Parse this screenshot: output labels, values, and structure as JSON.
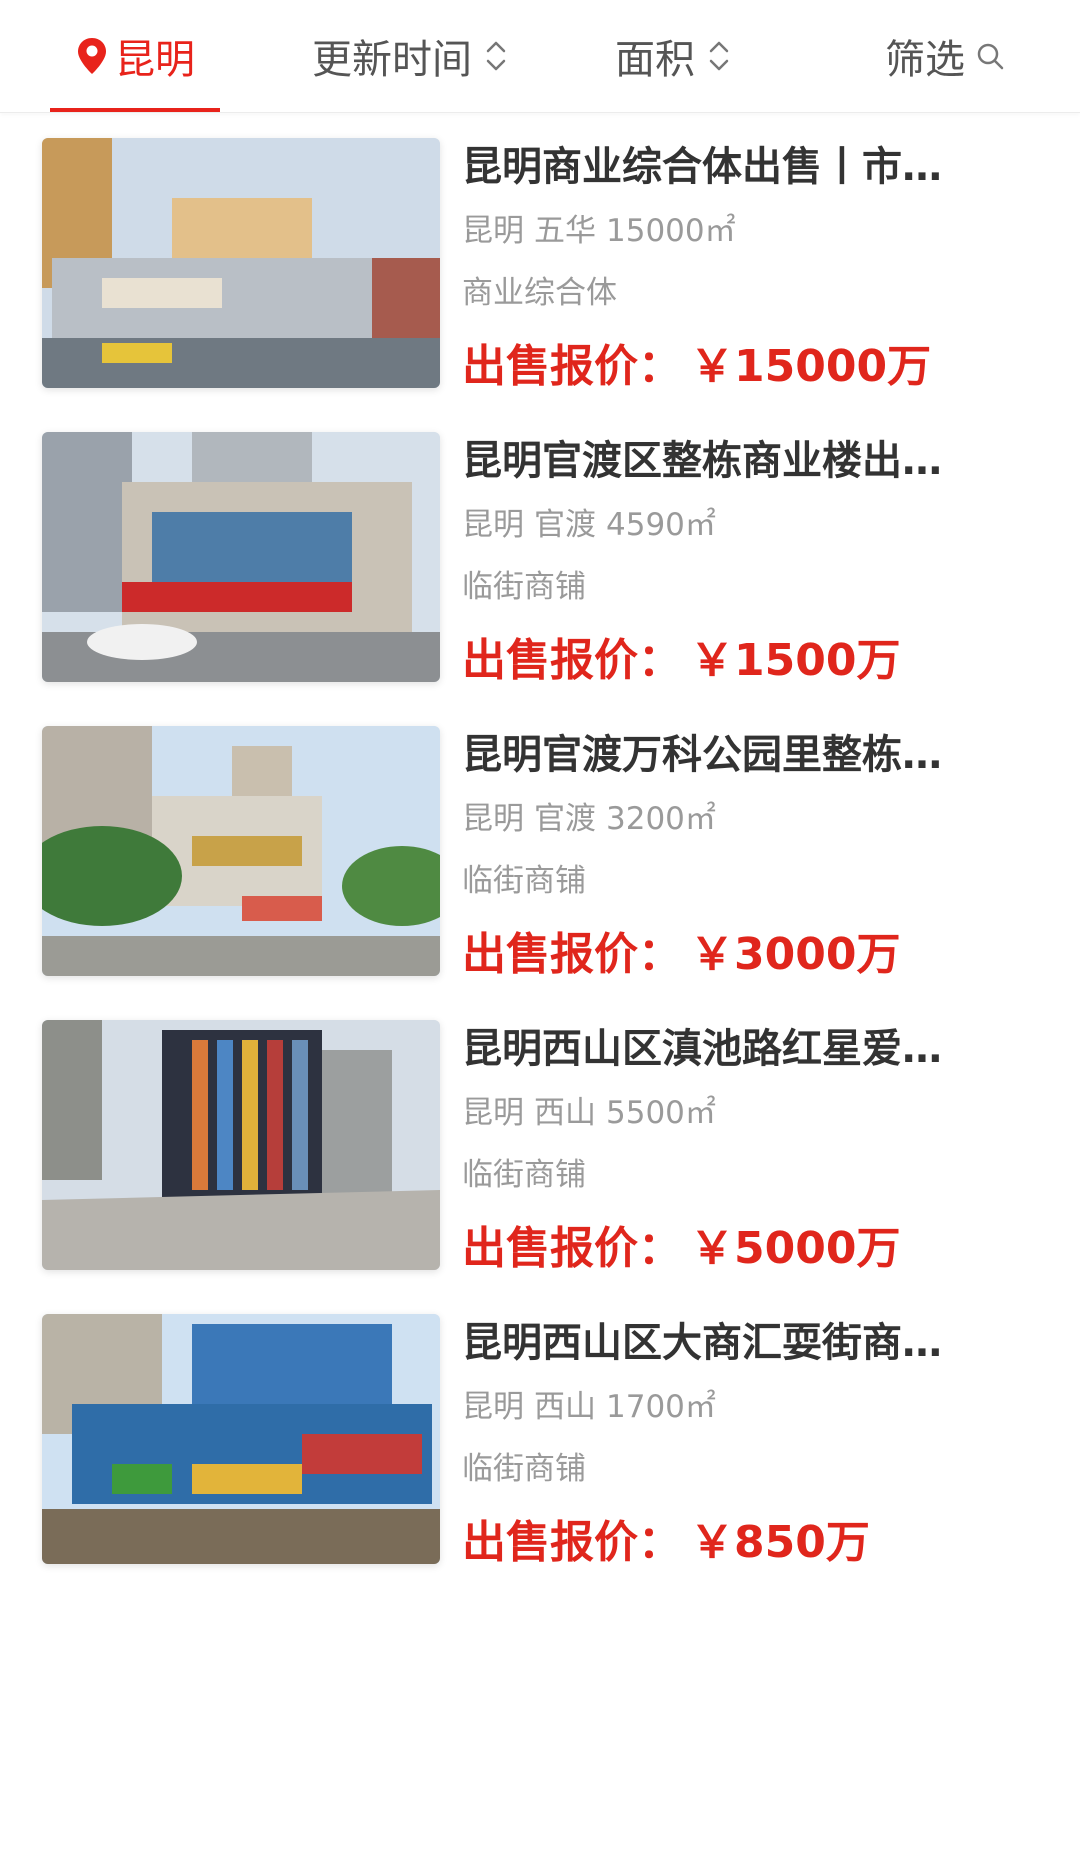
{
  "filter_bar": {
    "city": "昆明",
    "update_time": "更新时间",
    "area": "面积",
    "filter": "筛选"
  },
  "listings": [
    {
      "title": "昆明商业综合体出售丨市…",
      "city": "昆明",
      "district": "五华",
      "area": "15000㎡",
      "type": "商业综合体",
      "price_label": "出售报价：",
      "price": "￥15000万"
    },
    {
      "title": "昆明官渡区整栋商业楼出…",
      "city": "昆明",
      "district": "官渡",
      "area": "4590㎡",
      "type": "临街商铺",
      "price_label": "出售报价：",
      "price": "￥1500万"
    },
    {
      "title": "昆明官渡万科公园里整栋…",
      "city": "昆明",
      "district": "官渡",
      "area": "3200㎡",
      "type": "临街商铺",
      "price_label": "出售报价：",
      "price": "￥3000万"
    },
    {
      "title": "昆明西山区滇池路红星爱…",
      "city": "昆明",
      "district": "西山",
      "area": "5500㎡",
      "type": "临街商铺",
      "price_label": "出售报价：",
      "price": "￥5000万"
    },
    {
      "title": "昆明西山区大商汇耍街商…",
      "city": "昆明",
      "district": "西山",
      "area": "1700㎡",
      "type": "临街商铺",
      "price_label": "出售报价：",
      "price": "￥850万"
    }
  ],
  "colors": {
    "accent": "#e8231b",
    "price": "#e0261c",
    "title": "#333333",
    "meta": "#9a9a9a"
  },
  "icons": {
    "city": "location-pin-icon",
    "sort": "sort-updown-icon",
    "filter": "search-icon"
  }
}
